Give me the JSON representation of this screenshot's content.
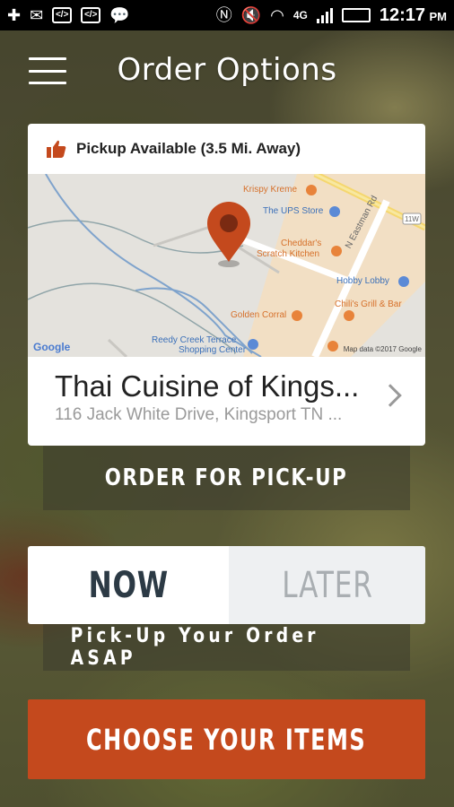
{
  "status_bar": {
    "time": "12:17",
    "ampm": "PM",
    "network": "4G",
    "battery_level": 0.85,
    "icons": [
      "add-icon",
      "gmail-icon",
      "code-icon",
      "code-icon",
      "messenger-icon",
      "nfc-icon",
      "mute-icon",
      "wifi-icon",
      "4g-lte-icon",
      "signal-icon",
      "battery-icon"
    ]
  },
  "header": {
    "title": "Order Options",
    "menu_icon": "hamburger-menu-icon"
  },
  "location_card": {
    "pickup_status": "Pickup Available (3.5 Mi. Away)",
    "restaurant_name": "Thai Cuisine of Kings...",
    "address": "116 Jack White Drive, Kingsport TN ...",
    "map": {
      "labels": {
        "krispy": "Krispy Kreme",
        "ups": "The UPS Store",
        "cheddars1": "Cheddar's",
        "cheddars2": "Scratch Kitchen",
        "eastman": "N Eastman Rd",
        "hobby": "Hobby Lobby",
        "chilis": "Chili's Grill & Bar",
        "golden": "Golden Corral",
        "reedy1": "Reedy Creek Terrace",
        "reedy2": "Shopping Center",
        "road11w": "11W",
        "google": "Google",
        "mapdata": "Map data ©2017 Google"
      },
      "accent_color": "#c4491d"
    }
  },
  "order_for_pickup": "ORDER FOR PICK-UP",
  "timing": {
    "now": "NOW",
    "later": "LATER",
    "selected": "NOW",
    "subtitle": "Pick-Up Your Order ASAP"
  },
  "choose_items": "CHOOSE YOUR ITEMS",
  "colors": {
    "brand": "#c4491d",
    "selected_text": "#2c3a45",
    "unselected_text": "#a9aeb2"
  }
}
